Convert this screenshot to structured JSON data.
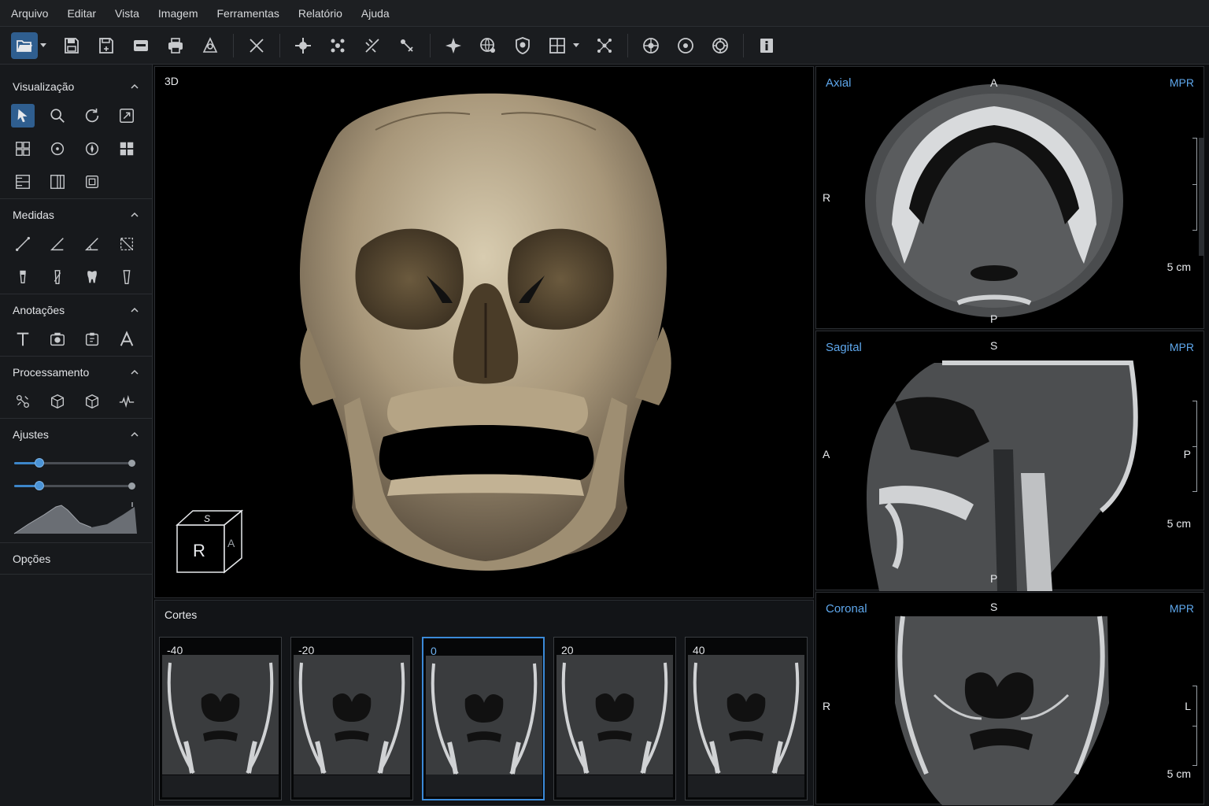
{
  "menu": [
    "Arquivo",
    "Editar",
    "Vista",
    "Imagem",
    "Ferramentas",
    "Relatório",
    "Ajuda"
  ],
  "toolbar": {
    "icons": [
      "open-folder-icon",
      "save-icon",
      "save-as-icon",
      "export-icon",
      "print-icon",
      "measure-tool-icon",
      "cut-icon",
      "move-icon",
      "nodes-icon",
      "ruler-icon",
      "probe-icon",
      "sparkle-icon",
      "globe-icon",
      "shield-icon",
      "layout-icon",
      "network-icon",
      "target-globe-icon",
      "crosshair-icon",
      "aperture-icon",
      "info-icon"
    ]
  },
  "sidebar": {
    "sections": {
      "visualizacao": "Visualização",
      "medidas": "Medidas",
      "anotacoes": "Anotações",
      "processamento": "Processamento",
      "ajustes": "Ajustes",
      "opcoes": "Opções"
    },
    "sliders": [
      0.21,
      0.21
    ]
  },
  "view3d": {
    "label": "3D",
    "cube": {
      "front": "R",
      "top": "S",
      "side": "A"
    }
  },
  "cortes": {
    "title": "Cortes",
    "slices": [
      "-40",
      "-20",
      "0",
      "20",
      "40"
    ],
    "selected": "0"
  },
  "mpr": {
    "axial": {
      "title": "Axial",
      "mode": "MPR",
      "top": "A",
      "left": "R",
      "bottom": "P",
      "scale": "5 cm"
    },
    "sagital": {
      "title": "Sagital",
      "mode": "MPR",
      "top": "S",
      "left": "A",
      "right": "P",
      "bottom": "P",
      "scale": "5 cm"
    },
    "coronal": {
      "title": "Coronal",
      "mode": "MPR",
      "top": "S",
      "left": "R",
      "right": "L",
      "scale": "5 cm"
    }
  },
  "colors": {
    "accent": "#3b8ad8",
    "mpr_label": "#5ea7ec",
    "bone": "#b7a78a"
  }
}
